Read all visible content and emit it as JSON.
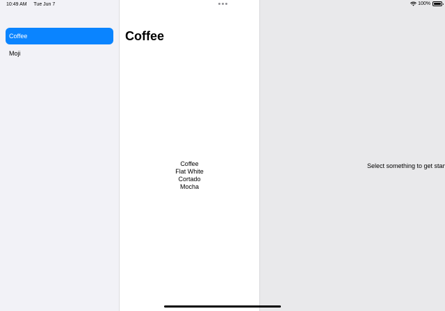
{
  "status_bar": {
    "time": "10:49 AM",
    "date": "Tue Jun 7",
    "battery": "100%",
    "battery_level": 1.0,
    "wifi_icon": "wifi-icon",
    "battery_icon": "battery-icon"
  },
  "sidebar": {
    "items": [
      {
        "label": "Coffee",
        "selected": true
      },
      {
        "label": "Moji",
        "selected": false
      }
    ]
  },
  "middle": {
    "title": "Coffee",
    "items": [
      "Coffee",
      "Flat White",
      "Cortado",
      "Mocha"
    ]
  },
  "detail": {
    "placeholder": "Select something to get started"
  },
  "colors": {
    "accent": "#0a84ff",
    "sidebar_bg": "#f2f2f7",
    "detail_bg": "#e9e9eb"
  }
}
